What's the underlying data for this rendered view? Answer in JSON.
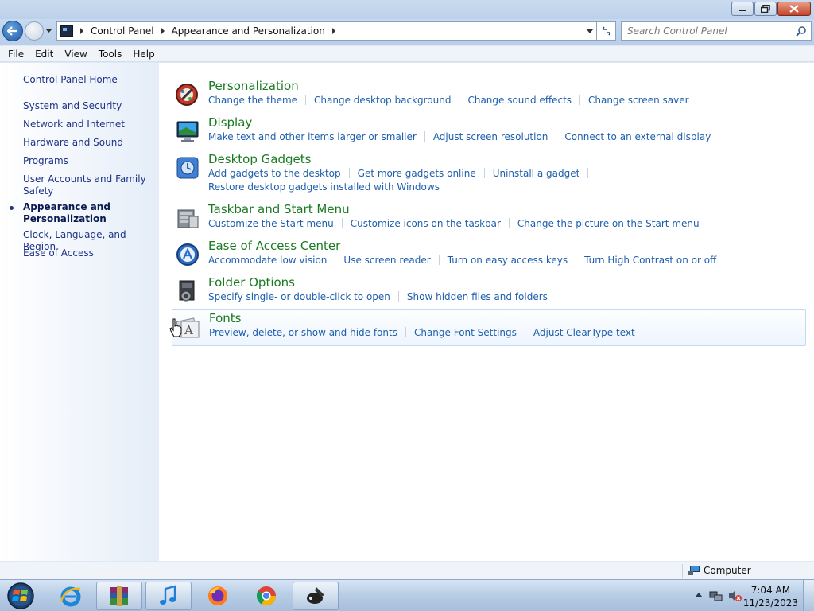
{
  "window": {
    "minimize_icon": "minimize-icon",
    "maximize_icon": "restore-icon",
    "close_icon": "close-icon"
  },
  "address": {
    "breadcrumbs": [
      "Control Panel",
      "Appearance and Personalization"
    ],
    "search_placeholder": "Search Control Panel"
  },
  "menubar": [
    "File",
    "Edit",
    "View",
    "Tools",
    "Help"
  ],
  "sidebar": {
    "home": "Control Panel Home",
    "items": [
      {
        "label": "System and Security",
        "active": false
      },
      {
        "label": "Network and Internet",
        "active": false
      },
      {
        "label": "Hardware and Sound",
        "active": false
      },
      {
        "label": "Programs",
        "active": false
      },
      {
        "label": "User Accounts and Family Safety",
        "active": false
      },
      {
        "label": "Appearance and Personalization",
        "active": true
      },
      {
        "label": "Clock, Language, and Region",
        "active": false
      },
      {
        "label": "Ease of Access",
        "active": false
      }
    ]
  },
  "categories": [
    {
      "title": "Personalization",
      "icon": "personalization-icon",
      "links": [
        "Change the theme",
        "Change desktop background",
        "Change sound effects",
        "Change screen saver"
      ]
    },
    {
      "title": "Display",
      "icon": "display-icon",
      "links": [
        "Make text and other items larger or smaller",
        "Adjust screen resolution",
        "Connect to an external display"
      ]
    },
    {
      "title": "Desktop Gadgets",
      "icon": "gadgets-icon",
      "links": [
        "Add gadgets to the desktop",
        "Get more gadgets online",
        "Uninstall a gadget",
        "Restore desktop gadgets installed with Windows"
      ]
    },
    {
      "title": "Taskbar and Start Menu",
      "icon": "taskbar-icon",
      "links": [
        "Customize the Start menu",
        "Customize icons on the taskbar",
        "Change the picture on the Start menu"
      ]
    },
    {
      "title": "Ease of Access Center",
      "icon": "ease-of-access-icon",
      "links": [
        "Accommodate low vision",
        "Use screen reader",
        "Turn on easy access keys",
        "Turn High Contrast on or off"
      ]
    },
    {
      "title": "Folder Options",
      "icon": "folder-options-icon",
      "links": [
        "Specify single- or double-click to open",
        "Show hidden files and folders"
      ]
    },
    {
      "title": "Fonts",
      "icon": "fonts-icon",
      "links": [
        "Preview, delete, or show and hide fonts",
        "Change Font Settings",
        "Adjust ClearType text"
      ]
    }
  ],
  "status": {
    "location": "Computer"
  },
  "taskbar": {
    "apps": [
      "start-orb-icon",
      "internet-explorer-icon",
      "winrar-icon",
      "itunes-icon",
      "firefox-icon",
      "chrome-icon",
      "paint-icon"
    ],
    "time": "7:04 AM",
    "date": "11/23/2023"
  },
  "colors": {
    "category_title": "#1a7a22",
    "link": "#1e5fad",
    "sidebar_link": "#1e3287"
  }
}
